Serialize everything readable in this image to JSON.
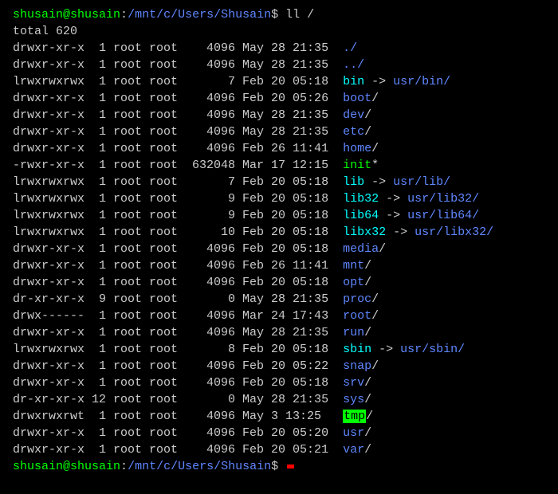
{
  "prompt": {
    "user": "shusain",
    "at": "@",
    "host": "shusain",
    "colon": ":",
    "path": "/mnt/c/Users/Shusain",
    "dollar": "$"
  },
  "command": "ll /",
  "total_label": "total 620",
  "listing": [
    {
      "perms": "drwxr-xr-x",
      "links": "1",
      "owner": "root",
      "group": "root",
      "size": "4096",
      "date": "May 28 21:35",
      "name": "./",
      "type": "dir"
    },
    {
      "perms": "drwxr-xr-x",
      "links": "1",
      "owner": "root",
      "group": "root",
      "size": "4096",
      "date": "May 28 21:35",
      "name": "../",
      "type": "dir"
    },
    {
      "perms": "lrwxrwxrwx",
      "links": "1",
      "owner": "root",
      "group": "root",
      "size": "7",
      "date": "Feb 20 05:18",
      "name": "bin",
      "type": "link",
      "arrow": " -> ",
      "target": "usr/bin/"
    },
    {
      "perms": "drwxr-xr-x",
      "links": "1",
      "owner": "root",
      "group": "root",
      "size": "4096",
      "date": "Feb 20 05:26",
      "name": "boot",
      "type": "dir",
      "suffix": "/"
    },
    {
      "perms": "drwxr-xr-x",
      "links": "1",
      "owner": "root",
      "group": "root",
      "size": "4096",
      "date": "May 28 21:35",
      "name": "dev",
      "type": "dir",
      "suffix": "/"
    },
    {
      "perms": "drwxr-xr-x",
      "links": "1",
      "owner": "root",
      "group": "root",
      "size": "4096",
      "date": "May 28 21:35",
      "name": "etc",
      "type": "dir",
      "suffix": "/"
    },
    {
      "perms": "drwxr-xr-x",
      "links": "1",
      "owner": "root",
      "group": "root",
      "size": "4096",
      "date": "Feb 26 11:41",
      "name": "home",
      "type": "dir",
      "suffix": "/"
    },
    {
      "perms": "-rwxr-xr-x",
      "links": "1",
      "owner": "root",
      "group": "root",
      "size": "632048",
      "date": "Mar 17 12:15",
      "name": "init",
      "type": "exec",
      "suffix": "*"
    },
    {
      "perms": "lrwxrwxrwx",
      "links": "1",
      "owner": "root",
      "group": "root",
      "size": "7",
      "date": "Feb 20 05:18",
      "name": "lib",
      "type": "link",
      "arrow": " -> ",
      "target": "usr/lib/"
    },
    {
      "perms": "lrwxrwxrwx",
      "links": "1",
      "owner": "root",
      "group": "root",
      "size": "9",
      "date": "Feb 20 05:18",
      "name": "lib32",
      "type": "link",
      "arrow": " -> ",
      "target": "usr/lib32/"
    },
    {
      "perms": "lrwxrwxrwx",
      "links": "1",
      "owner": "root",
      "group": "root",
      "size": "9",
      "date": "Feb 20 05:18",
      "name": "lib64",
      "type": "link",
      "arrow": " -> ",
      "target": "usr/lib64/"
    },
    {
      "perms": "lrwxrwxrwx",
      "links": "1",
      "owner": "root",
      "group": "root",
      "size": "10",
      "date": "Feb 20 05:18",
      "name": "libx32",
      "type": "link",
      "arrow": " -> ",
      "target": "usr/libx32/"
    },
    {
      "perms": "drwxr-xr-x",
      "links": "1",
      "owner": "root",
      "group": "root",
      "size": "4096",
      "date": "Feb 20 05:18",
      "name": "media",
      "type": "dir",
      "suffix": "/"
    },
    {
      "perms": "drwxr-xr-x",
      "links": "1",
      "owner": "root",
      "group": "root",
      "size": "4096",
      "date": "Feb 26 11:41",
      "name": "mnt",
      "type": "dir",
      "suffix": "/"
    },
    {
      "perms": "drwxr-xr-x",
      "links": "1",
      "owner": "root",
      "group": "root",
      "size": "4096",
      "date": "Feb 20 05:18",
      "name": "opt",
      "type": "dir",
      "suffix": "/"
    },
    {
      "perms": "dr-xr-xr-x",
      "links": "9",
      "owner": "root",
      "group": "root",
      "size": "0",
      "date": "May 28 21:35",
      "name": "proc",
      "type": "dir",
      "suffix": "/"
    },
    {
      "perms": "drwx------",
      "links": "1",
      "owner": "root",
      "group": "root",
      "size": "4096",
      "date": "Mar 24 17:43",
      "name": "root",
      "type": "dir",
      "suffix": "/"
    },
    {
      "perms": "drwxr-xr-x",
      "links": "1",
      "owner": "root",
      "group": "root",
      "size": "4096",
      "date": "May 28 21:35",
      "name": "run",
      "type": "dir",
      "suffix": "/"
    },
    {
      "perms": "lrwxrwxrwx",
      "links": "1",
      "owner": "root",
      "group": "root",
      "size": "8",
      "date": "Feb 20 05:18",
      "name": "sbin",
      "type": "link",
      "arrow": " -> ",
      "target": "usr/sbin/"
    },
    {
      "perms": "drwxr-xr-x",
      "links": "1",
      "owner": "root",
      "group": "root",
      "size": "4096",
      "date": "Feb 20 05:22",
      "name": "snap",
      "type": "dir",
      "suffix": "/"
    },
    {
      "perms": "drwxr-xr-x",
      "links": "1",
      "owner": "root",
      "group": "root",
      "size": "4096",
      "date": "Feb 20 05:18",
      "name": "srv",
      "type": "dir",
      "suffix": "/"
    },
    {
      "perms": "dr-xr-xr-x",
      "links": "12",
      "owner": "root",
      "group": "root",
      "size": "0",
      "date": "May 28 21:35",
      "name": "sys",
      "type": "dir",
      "suffix": "/"
    },
    {
      "perms": "drwxrwxrwt",
      "links": "1",
      "owner": "root",
      "group": "root",
      "size": "4096",
      "date": "May  3 13:25",
      "name": "tmp",
      "type": "sticky",
      "suffix": "/"
    },
    {
      "perms": "drwxr-xr-x",
      "links": "1",
      "owner": "root",
      "group": "root",
      "size": "4096",
      "date": "Feb 20 05:20",
      "name": "usr",
      "type": "dir",
      "suffix": "/"
    },
    {
      "perms": "drwxr-xr-x",
      "links": "1",
      "owner": "root",
      "group": "root",
      "size": "4096",
      "date": "Feb 20 05:21",
      "name": "var",
      "type": "dir",
      "suffix": "/"
    }
  ]
}
